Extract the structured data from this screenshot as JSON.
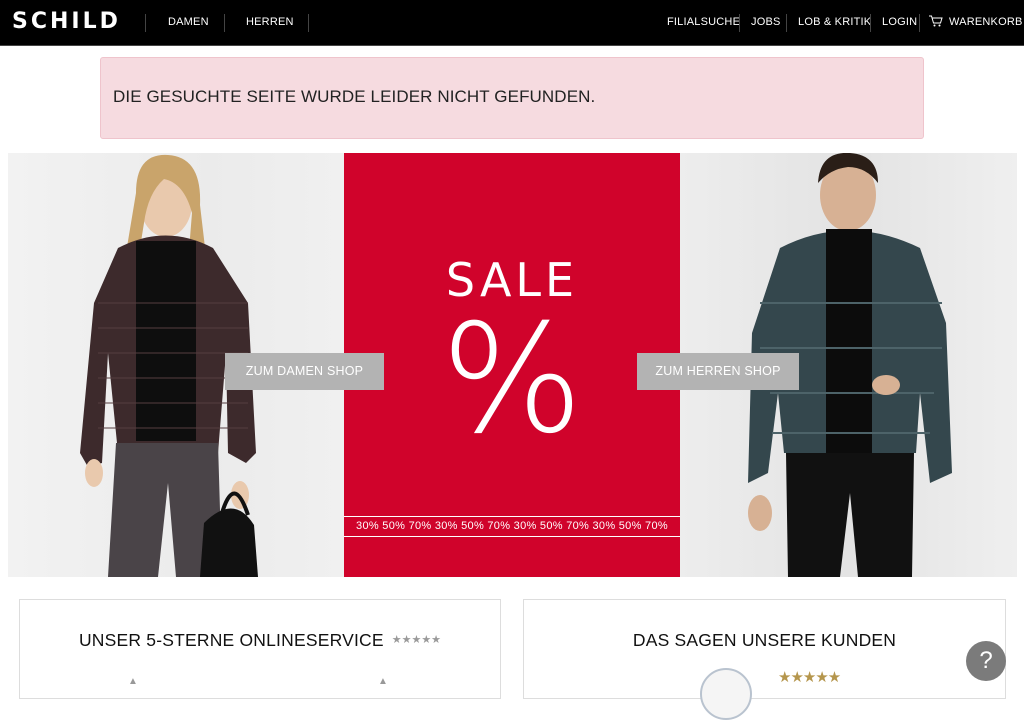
{
  "header": {
    "logo": "SCHILD",
    "nav_left": [
      "DAMEN",
      "HERREN"
    ],
    "nav_right": [
      "FILIALSUCHE",
      "JOBS",
      "LOB & KRITIK",
      "LOGIN",
      "WARENKORB"
    ]
  },
  "alert": {
    "message": "DIE GESUCHTE SEITE WURDE LEIDER NICHT GEFUNDEN."
  },
  "hero": {
    "sale_title": "SALE",
    "sale_symbol": "%",
    "sale_strip": "30% 50% 70% 30% 50% 70% 30% 50% 70% 30% 50% 70%",
    "damen_button": "ZUM DAMEN SHOP",
    "herren_button": "ZUM HERREN SHOP",
    "sale_color": "#d0032b"
  },
  "cards": {
    "service_title": "UNSER 5-STERNE ONLINESERVICE",
    "service_stars": "★★★★★",
    "reviews_title": "DAS SAGEN UNSERE KUNDEN",
    "reviews_stars": "★★★★★"
  },
  "help": {
    "label": "?"
  }
}
